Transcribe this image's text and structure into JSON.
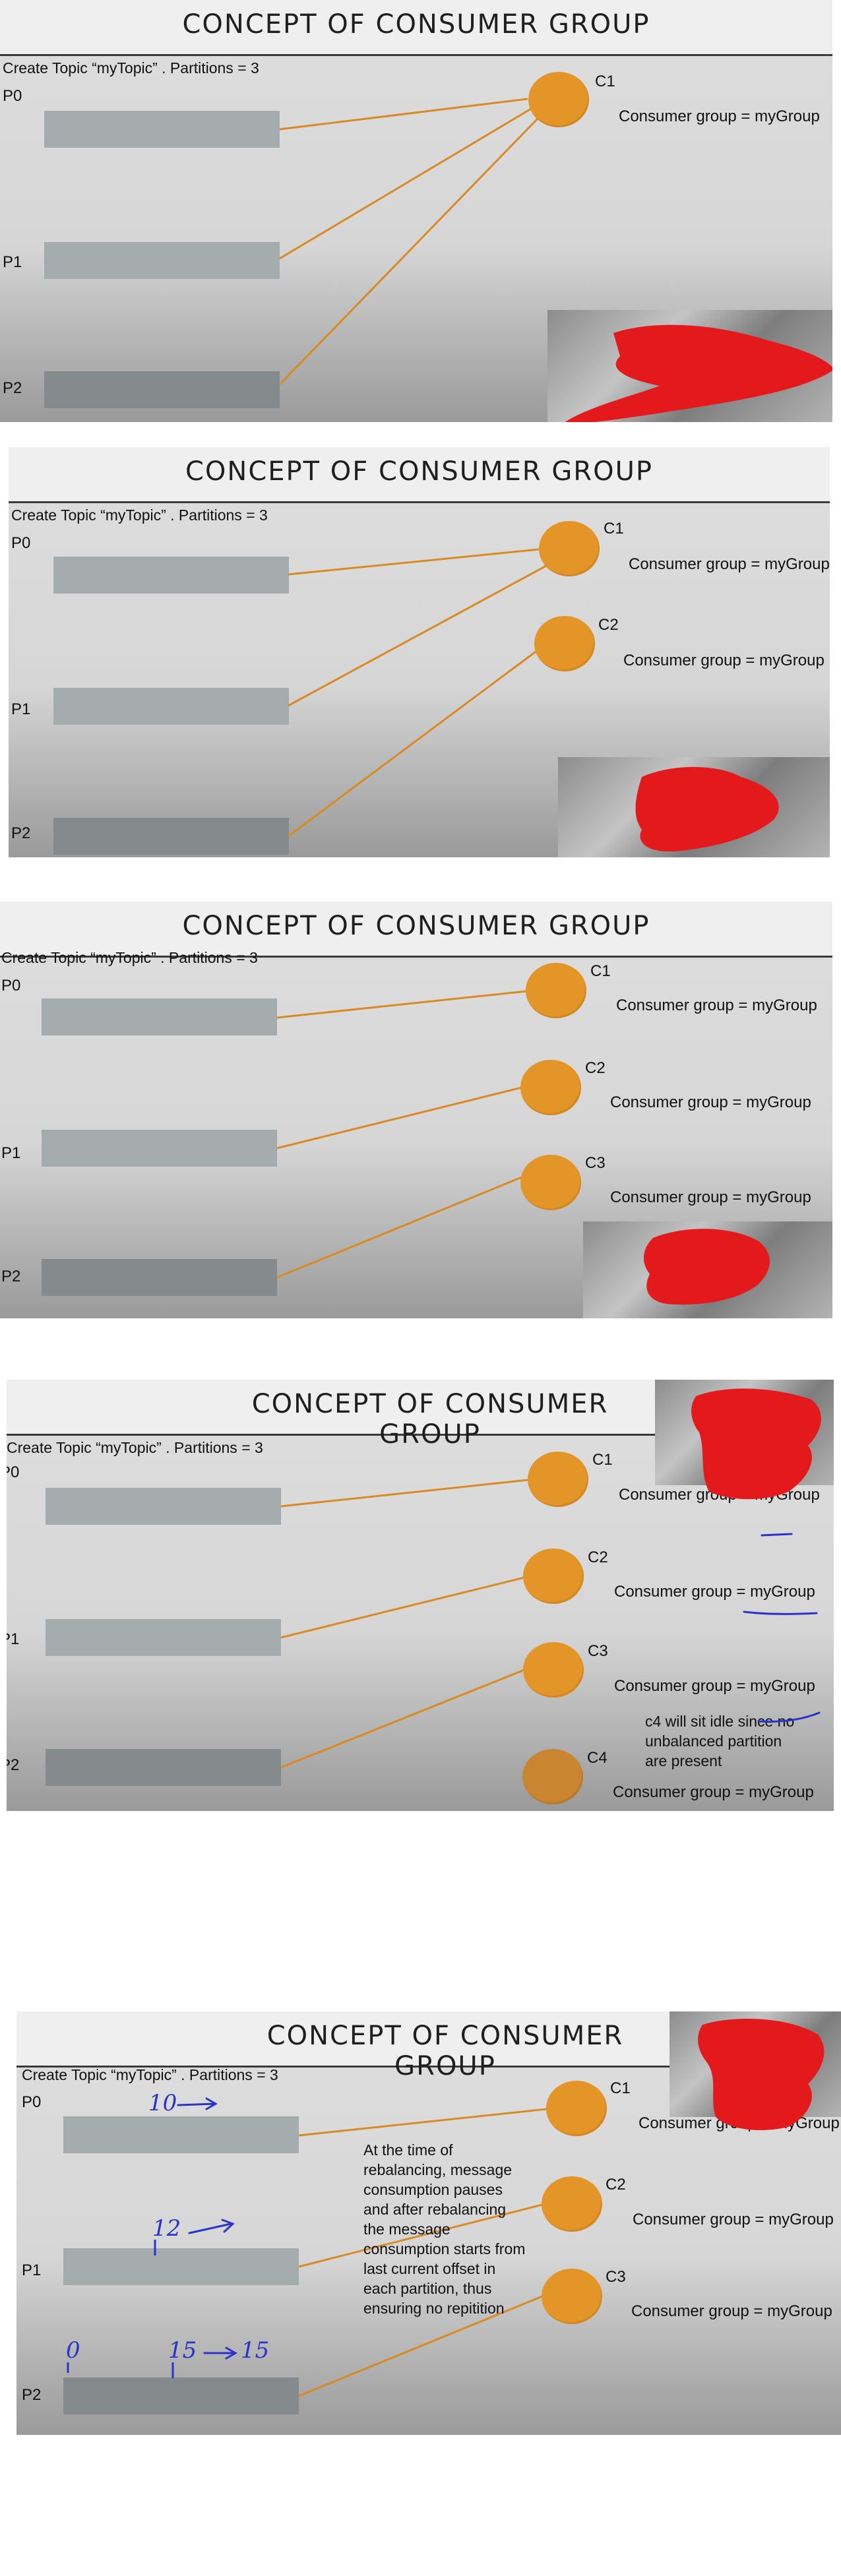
{
  "slides": [
    {
      "title": "CONCEPT OF CONSUMER GROUP",
      "topic": "Create Topic “myTopic” .  Partitions = 3",
      "partitions": [
        "P0",
        "P1",
        "P2"
      ],
      "consumers": [
        {
          "label": "C1",
          "group": "Consumer group = myGroup"
        }
      ]
    },
    {
      "title": "CONCEPT OF CONSUMER GROUP",
      "topic": "Create Topic “myTopic” .  Partitions = 3",
      "partitions": [
        "P0",
        "P1",
        "P2"
      ],
      "consumers": [
        {
          "label": "C1",
          "group": "Consumer group = myGroup"
        },
        {
          "label": "C2",
          "group": "Consumer group = myGroup"
        }
      ]
    },
    {
      "title": "CONCEPT OF CONSUMER GROUP",
      "topic": "Create Topic “myTopic” .  Partitions = 3",
      "partitions": [
        "P0",
        "P1",
        "P2"
      ],
      "consumers": [
        {
          "label": "C1",
          "group": "Consumer group = myGroup"
        },
        {
          "label": "C2",
          "group": "Consumer group = myGroup"
        },
        {
          "label": "C3",
          "group": "Consumer group = myGroup"
        }
      ]
    },
    {
      "title": "CONCEPT OF CONSUMER GROUP",
      "topic": "Create Topic “myTopic” .  Partitions = 3",
      "partitions": [
        "P0",
        "P1",
        "P2"
      ],
      "consumers": [
        {
          "label": "C1",
          "group": "Consumer group = myGroup"
        },
        {
          "label": "C2",
          "group": "Consumer group = myGroup"
        },
        {
          "label": "C3",
          "group": "Consumer group = myGroup"
        },
        {
          "label": "C4",
          "group": "Consumer group = myGroup"
        }
      ],
      "note": "c4 will sit idle since no unbalanced partition are present"
    },
    {
      "title": "CONCEPT OF CONSUMER GROUP",
      "topic": "Create Topic “myTopic” .  Partitions = 3",
      "partitions": [
        "P0",
        "P1",
        "P2"
      ],
      "consumers": [
        {
          "label": "C1",
          "group": "Consumer group = myGroup"
        },
        {
          "label": "C2",
          "group": "Consumer group = myGroup"
        },
        {
          "label": "C3",
          "group": "Consumer group = myGroup"
        }
      ],
      "note": "At the time of rebalancing, message consumption pauses and after rebalancing the message consumption starts from last current offset in each partition, thus ensuring no repitition",
      "handwriting": {
        "p0_offset": "10",
        "p1_offset": "12",
        "p2_left": "0",
        "p2_offset": "15",
        "p2_target": "15"
      }
    }
  ],
  "colors": {
    "consumer": "#e49527",
    "arrow": "#d98a23",
    "partition": "#a5acad",
    "redaction": "#e3191b",
    "ink": "#2b33c9"
  }
}
